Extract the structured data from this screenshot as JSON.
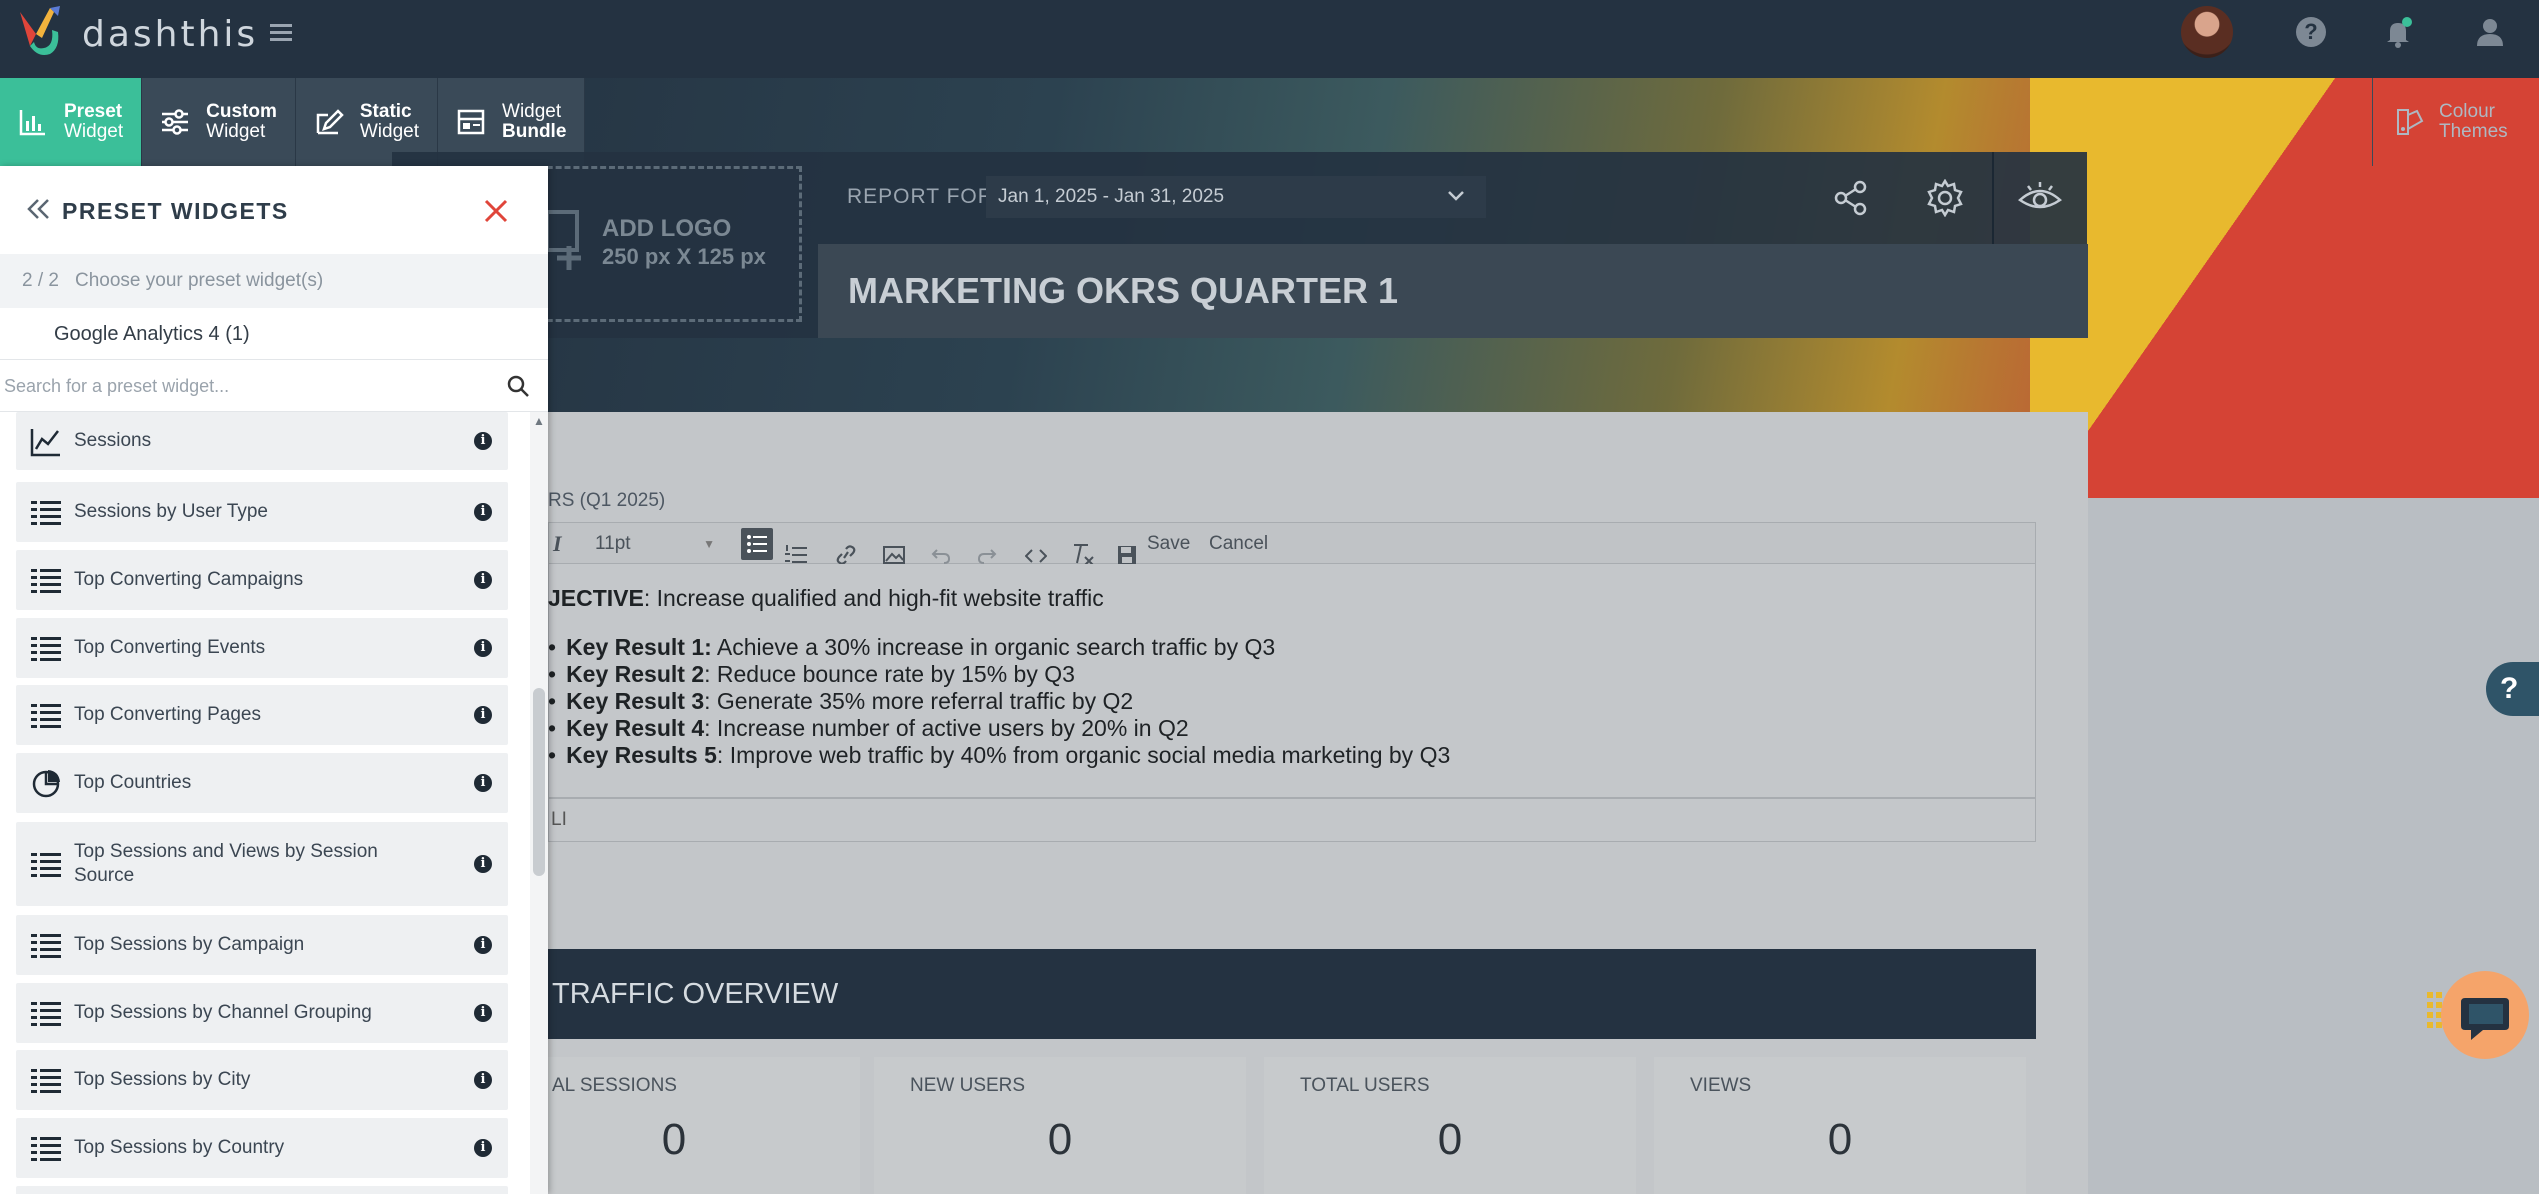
{
  "app": {
    "name": "dashthis"
  },
  "widget_tabs": [
    {
      "line1": "Preset",
      "line2": "Widget",
      "active": true
    },
    {
      "line1": "Custom",
      "line2": "Widget",
      "active": false
    },
    {
      "line1": "Static",
      "line2": "Widget",
      "active": false
    },
    {
      "line1": "Widget",
      "line2": "Bundle",
      "active": false
    }
  ],
  "colour_themes": {
    "line1": "Colour",
    "line2": "Themes"
  },
  "report": {
    "logo_placeholder_title": "ADD LOGO",
    "logo_placeholder_size": "250 px X 125 px",
    "report_for_label": "REPORT FOR",
    "date_range": "Jan 1, 2025 - Jan 31, 2025",
    "title": "MARKETING OKRS QUARTER 1"
  },
  "editor": {
    "caption": "RS (Q1 2025)",
    "font_size": "11pt",
    "save_label": "Save",
    "cancel_label": "Cancel",
    "objective_prefix": "JECTIVE",
    "objective_text": ": Increase qualified and high-fit website traffic",
    "key_results": [
      {
        "label": "Key Result 1:",
        "text": " Achieve a 30% increase in organic search traffic by Q3"
      },
      {
        "label": "Key Result 2",
        "text": ": Reduce bounce rate by 15% by Q3"
      },
      {
        "label": "Key Result 3",
        "text": ": Generate 35% more referral traffic by Q2"
      },
      {
        "label": "Key Result 4",
        "text": ": Increase number of active users by 20% in Q2"
      },
      {
        "label": "Key Results 5",
        "text": ": Improve web traffic by 40% from organic social media marketing by Q3"
      }
    ],
    "status_path": "LI"
  },
  "traffic": {
    "title": "TRAFFIC OVERVIEW",
    "metrics": [
      {
        "label": "AL SESSIONS",
        "value": "0"
      },
      {
        "label": "NEW USERS",
        "value": "0"
      },
      {
        "label": "TOTAL USERS",
        "value": "0"
      },
      {
        "label": "VIEWS",
        "value": "0"
      }
    ]
  },
  "panel": {
    "title": "PRESET WIDGETS",
    "step": "2 / 2",
    "step_hint": "Choose your preset widget(s)",
    "source": "Google Analytics 4 (1)",
    "search_placeholder": "Search for a preset widget...",
    "items": [
      {
        "label": "Sessions",
        "icon": "line-chart-icon"
      },
      {
        "label": "Sessions by User Type",
        "icon": "table-icon"
      },
      {
        "label": "Top Converting Campaigns",
        "icon": "table-icon"
      },
      {
        "label": "Top Converting Events",
        "icon": "table-icon"
      },
      {
        "label": "Top Converting Pages",
        "icon": "table-icon"
      },
      {
        "label": "Top Countries",
        "icon": "pie-chart-icon"
      },
      {
        "label": "Top Sessions and Views by Session Source",
        "icon": "table-icon"
      },
      {
        "label": "Top Sessions by Campaign",
        "icon": "table-icon"
      },
      {
        "label": "Top Sessions by Channel Grouping",
        "icon": "table-icon"
      },
      {
        "label": "Top Sessions by City",
        "icon": "table-icon"
      },
      {
        "label": "Top Sessions by Country",
        "icon": "table-icon"
      }
    ]
  },
  "float_help": "?"
}
